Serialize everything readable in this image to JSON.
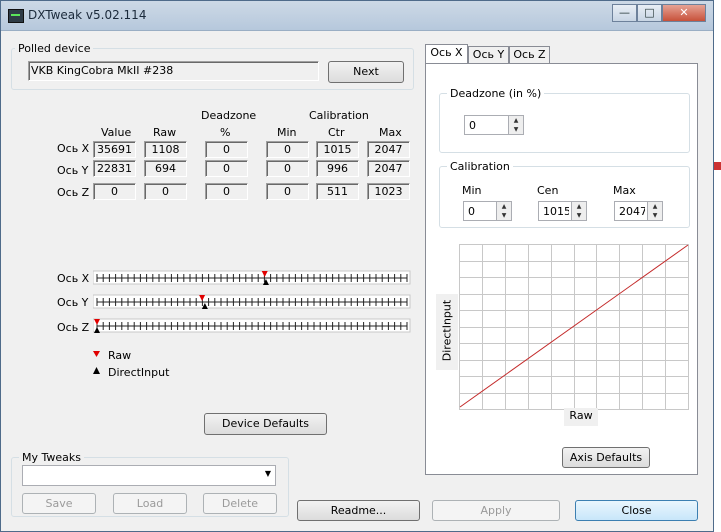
{
  "window": {
    "title": "DXTweak v5.02.114",
    "minimize": "—",
    "maximize": "□",
    "close": "✕"
  },
  "polled": {
    "group_label": "Polled device",
    "device_name": "VKB KingCobra MkII  #238",
    "next_label": "Next"
  },
  "table": {
    "header_deadzone": "Deadzone",
    "header_calibration": "Calibration",
    "col_value": "Value",
    "col_raw": "Raw",
    "col_pct": "%",
    "col_min": "Min",
    "col_ctr": "Ctr",
    "col_max": "Max",
    "rows": [
      {
        "axis": "Ось X",
        "value": "35691",
        "raw": "1108",
        "dz": "0",
        "min": "0",
        "ctr": "1015",
        "max": "2047"
      },
      {
        "axis": "Ось Y",
        "value": "22831",
        "raw": "694",
        "dz": "0",
        "min": "0",
        "ctr": "996",
        "max": "2047"
      },
      {
        "axis": "Ось Z",
        "value": "0",
        "raw": "0",
        "dz": "0",
        "min": "0",
        "ctr": "511",
        "max": "1023"
      }
    ]
  },
  "sliders": [
    {
      "axis": "Ось X",
      "raw_fraction": 0.541,
      "di_fraction": 0.545
    },
    {
      "axis": "Ось Y",
      "raw_fraction": 0.339,
      "di_fraction": 0.348
    },
    {
      "axis": "Ось Z",
      "raw_fraction": 0.0,
      "di_fraction": 0.0
    }
  ],
  "legend": {
    "raw": "Raw",
    "directinput": "DirectInput",
    "raw_color": "#e00000",
    "di_color": "#000000"
  },
  "device_defaults_label": "Device Defaults",
  "tweaks": {
    "group_label": "My Tweaks",
    "combo_value": "",
    "save": "Save",
    "load": "Load",
    "delete": "Delete"
  },
  "bottom": {
    "readme": "Readme...",
    "apply": "Apply",
    "close": "Close"
  },
  "tabs": [
    {
      "label": "Ось X",
      "active": true
    },
    {
      "label": "Ось Y",
      "active": false
    },
    {
      "label": "Ось Z",
      "active": false
    }
  ],
  "axis_panel": {
    "deadzone_label": "Deadzone (in %)",
    "deadzone_value": "0",
    "calibration_label": "Calibration",
    "min_label": "Min",
    "min_value": "0",
    "cen_label": "Cen",
    "cen_value": "1015",
    "max_label": "Max",
    "max_value": "2047",
    "graph_ylabel": "DirectInput",
    "graph_xlabel": "Raw",
    "axis_defaults_label": "Axis Defaults"
  }
}
